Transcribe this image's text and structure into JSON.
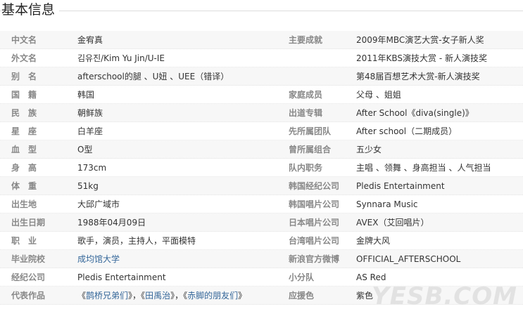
{
  "section": {
    "title": "基本信息"
  },
  "rows": [
    {
      "label1": "中文名",
      "value1": "金宥真",
      "label2": "主要成就",
      "value2": "2009年MBC演艺大赏-女子新人奖"
    },
    {
      "label1": "外文名",
      "value1": "김유진/Kim Yu Jin/U-IE",
      "label2": "",
      "value2": "2011年KBS演技大赏 - 新人演技奖"
    },
    {
      "label1": "别　名",
      "value1": "afterschool的腿 、U妞 、UEE（错译）",
      "label2": "",
      "value2": "第48届百想艺术大赏-新人演技奖"
    },
    {
      "label1": "国　籍",
      "value1": "韩国",
      "label2": "家庭成员",
      "value2": "父母 、姐姐"
    },
    {
      "label1": "民　族",
      "value1": "朝鲜族",
      "label2": "出道专辑",
      "value2": "After School《diva(single)》"
    },
    {
      "label1": "星　座",
      "value1": "白羊座",
      "label2": "先所属团队",
      "value2": "After school（二期成员）"
    },
    {
      "label1": "血　型",
      "value1": "O型",
      "label2": "曾所属组合",
      "value2": "五少女"
    },
    {
      "label1": "身　高",
      "value1": "173cm",
      "label2": "队内职务",
      "value2": "主唱 、领舞 、身高担当 、人气担当"
    },
    {
      "label1": "体　重",
      "value1": "51kg",
      "label2": "韩国经纪公司",
      "value2": "Pledis Entertainment"
    },
    {
      "label1": "出生地",
      "value1": "大邱广域市",
      "label2": "韩国唱片公司",
      "value2": "Synnara Music"
    },
    {
      "label1": "出生日期",
      "value1": "1988年04月09日",
      "label2": "日本唱片公司",
      "value2": "AVEX（艾回唱片）"
    },
    {
      "label1": "职　业",
      "value1": "歌手，演员，主持人，平面模特",
      "label2": "台湾唱片公司",
      "value2": "金牌大风"
    },
    {
      "label1": "毕业院校",
      "value1": "成均馆大学",
      "label2": "新浪官方微博",
      "value2": "OFFICIAL_AFTERSCHOOL"
    },
    {
      "label1": "经纪公司",
      "value1": "Pledis Entertainment",
      "label2": "小分队",
      "value2": "AS Red"
    },
    {
      "label1": "代表作品",
      "label2": "应援色",
      "value2": "紫色"
    }
  ],
  "works": {
    "open1": "《",
    "link1": "鹊桥兄弟们",
    "close1": "》，",
    "open2": "《",
    "link2": "田禹治",
    "close2": "》，",
    "open3": "《",
    "link3": "赤脚的朋友们",
    "close3": "》"
  },
  "watermark": "YESB.COM"
}
